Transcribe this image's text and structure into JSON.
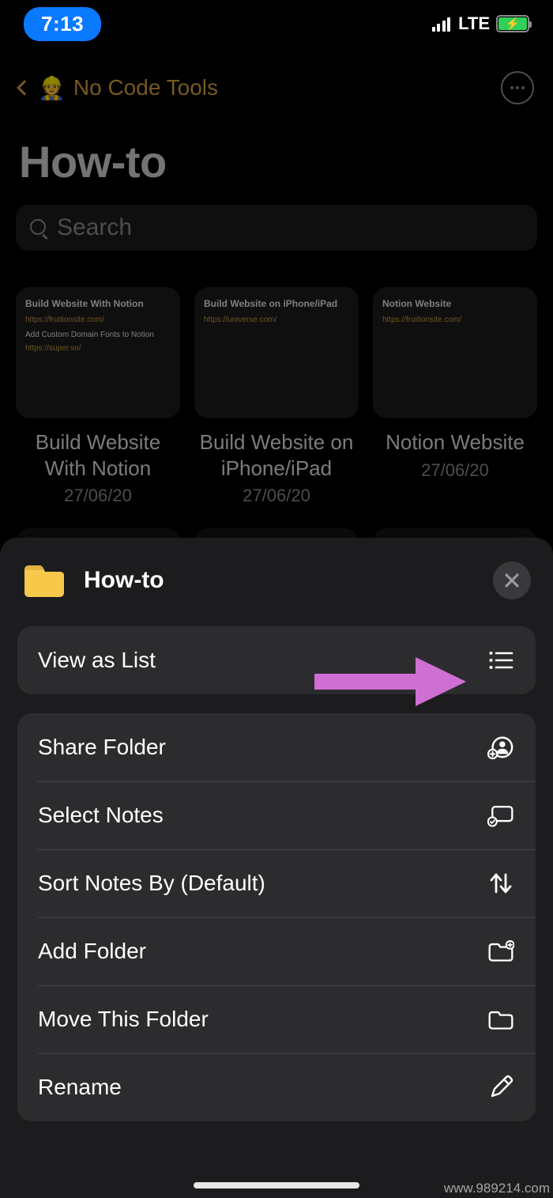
{
  "status": {
    "time": "7:13",
    "network": "LTE"
  },
  "breadcrumb": {
    "emoji": "👷",
    "title": "No Code Tools"
  },
  "page": {
    "title": "How-to"
  },
  "search": {
    "placeholder": "Search"
  },
  "notes": [
    {
      "title": "Build Website With Notion",
      "date": "27/06/20",
      "thumb_title": "Build Website With Notion",
      "thumb_link1": "https://fruitionsite.com/",
      "thumb_line": "Add Custom Domain Fonts to Notion",
      "thumb_link2": "https://super.so/"
    },
    {
      "title": "Build Website on iPhone/iPad",
      "date": "27/06/20",
      "thumb_title": "Build Website on iPhone/iPad",
      "thumb_link1": "https://universe.com/"
    },
    {
      "title": "Notion Website",
      "date": "27/06/20",
      "thumb_title": "Notion Website",
      "thumb_link1": "https://fruitionsite.com/"
    }
  ],
  "sheet": {
    "folder_name": "How-to",
    "group1": [
      {
        "label": "View as List",
        "icon": "list"
      }
    ],
    "group2": [
      {
        "label": "Share Folder",
        "icon": "share-person"
      },
      {
        "label": "Select Notes",
        "icon": "select"
      },
      {
        "label": "Sort Notes By (Default)",
        "icon": "sort"
      },
      {
        "label": "Add Folder",
        "icon": "folder-plus"
      },
      {
        "label": "Move This Folder",
        "icon": "folder"
      },
      {
        "label": "Rename",
        "icon": "pencil"
      }
    ]
  },
  "watermark": "www.989214.com"
}
